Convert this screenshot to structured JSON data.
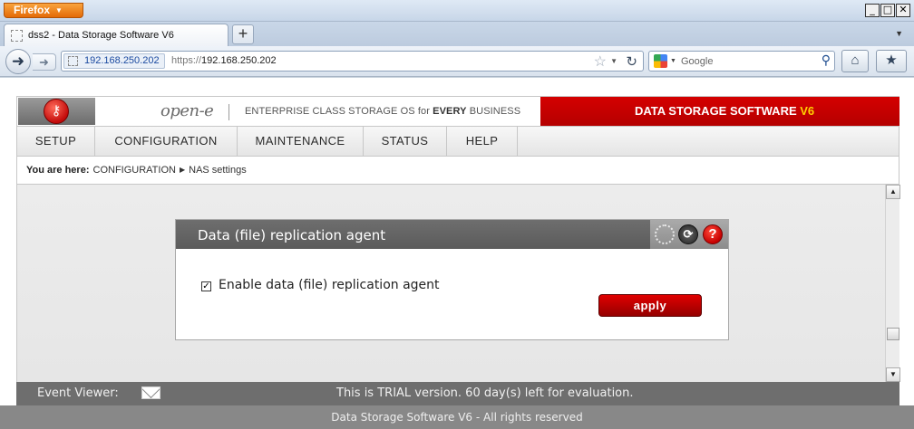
{
  "browser": {
    "menu_button": "Firefox",
    "tab_title": "dss2 - Data Storage Software V6",
    "new_tab": "+",
    "site_identity": "192.168.250.202",
    "url_scheme": "https://",
    "url_host": "192.168.250.202",
    "search_placeholder": "Google"
  },
  "app": {
    "brand": "open-e",
    "tagline_pre": "ENTERPRISE CLASS STORAGE OS for ",
    "tagline_bold": "EVERY",
    "tagline_post": " BUSINESS",
    "product": "DATA STORAGE SOFTWARE ",
    "product_version": "V6",
    "menu": [
      {
        "label": "SETUP"
      },
      {
        "label": "CONFIGURATION"
      },
      {
        "label": "MAINTENANCE"
      },
      {
        "label": "STATUS"
      },
      {
        "label": "HELP"
      }
    ],
    "breadcrumb": {
      "prefix": "You are here:",
      "items": [
        "CONFIGURATION",
        "NAS settings"
      ]
    },
    "panel": {
      "title": "Data (file) replication agent",
      "checkbox_label": "Enable data (file) replication agent",
      "checkbox_checked": true,
      "apply_label": "apply"
    },
    "status": {
      "event_viewer": "Event Viewer:",
      "trial": "This is TRIAL version. 60 day(s) left for evaluation."
    },
    "footer": "Data Storage Software V6 - All rights reserved"
  },
  "colors": {
    "brand_red": "#c80000",
    "version_yellow": "#ffd000",
    "panel_header": "#636363"
  },
  "icons": [
    "dropdown-icon",
    "page-icon",
    "back-icon",
    "forward-icon",
    "star-icon",
    "reload-icon",
    "google-icon",
    "magnifier-icon",
    "home-icon",
    "bookmarks-icon",
    "key-icon",
    "spinner-icon",
    "refresh-icon",
    "help-icon",
    "envelope-icon"
  ]
}
